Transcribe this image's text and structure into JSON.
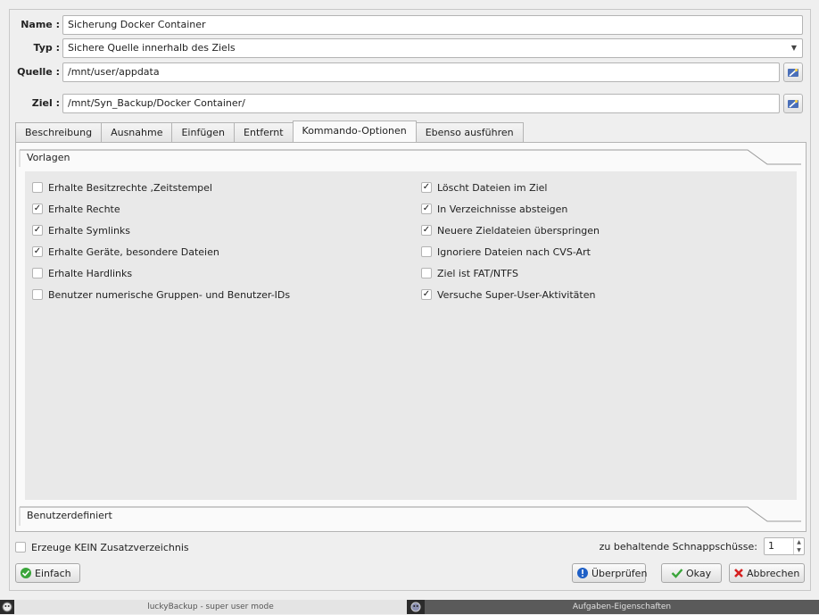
{
  "form": {
    "name_label": "Name :",
    "name_value": "Sicherung Docker Container",
    "type_label": "Typ :",
    "type_value": "Sichere Quelle innerhalb des Ziels",
    "source_label": "Quelle :",
    "source_value": "/mnt/user/appdata",
    "dest_label": "Ziel :",
    "dest_value": "/mnt/Syn_Backup/Docker Container/"
  },
  "tabs": [
    {
      "label": "Beschreibung",
      "active": false
    },
    {
      "label": "Ausnahme",
      "active": false
    },
    {
      "label": "Einfügen",
      "active": false
    },
    {
      "label": "Entfernt",
      "active": false
    },
    {
      "label": "Kommando-Optionen",
      "active": true
    },
    {
      "label": "Ebenso ausführen",
      "active": false
    }
  ],
  "templates_header": "Vorlagen",
  "custom_header": "Benutzerdefiniert",
  "options_left": [
    {
      "label": "Erhalte Besitzrechte ,Zeitstempel",
      "checked": false
    },
    {
      "label": "Erhalte Rechte",
      "checked": true
    },
    {
      "label": "Erhalte Symlinks",
      "checked": true
    },
    {
      "label": "Erhalte Geräte, besondere Dateien",
      "checked": true
    },
    {
      "label": "Erhalte Hardlinks",
      "checked": false
    },
    {
      "label": "Benutzer numerische Gruppen- und Benutzer-IDs",
      "checked": false
    }
  ],
  "options_right": [
    {
      "label": "Löscht Dateien im Ziel",
      "checked": true
    },
    {
      "label": "In Verzeichnisse absteigen",
      "checked": true
    },
    {
      "label": "Neuere Zieldateien überspringen",
      "checked": true
    },
    {
      "label": "Ignoriere Dateien nach CVS-Art",
      "checked": false
    },
    {
      "label": "Ziel ist FAT/NTFS",
      "checked": false
    },
    {
      "label": "Versuche Super-User-Aktivitäten",
      "checked": true
    }
  ],
  "no_extra_dir": {
    "label": "Erzeuge KEIN Zusatzverzeichnis",
    "checked": false
  },
  "snapshots": {
    "label": "zu behaltende Schnappschüsse:",
    "value": "1"
  },
  "buttons": {
    "simple": "Einfach",
    "validate": "Überprüfen",
    "okay": "Okay",
    "cancel": "Abbrechen"
  },
  "taskbar": {
    "task1": "luckyBackup - super user mode",
    "task2": "Aufgaben-Eigenschaften"
  },
  "colors": {
    "window_bg": "#efefef",
    "taskbar_bg": "#2b2b2b",
    "ok_green": "#3aa53a",
    "cancel_red": "#d62020",
    "info_blue": "#1e5fc6"
  }
}
